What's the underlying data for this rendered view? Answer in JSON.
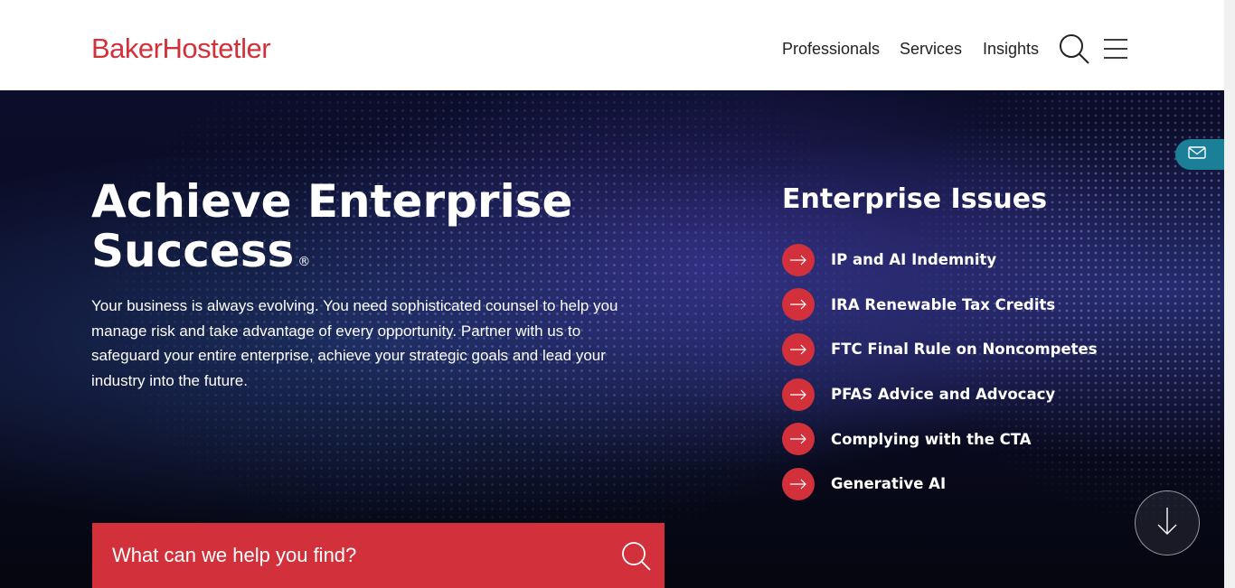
{
  "header": {
    "logo": "BakerHostetler",
    "nav": [
      "Professionals",
      "Services",
      "Insights"
    ],
    "search_icon": "search-icon",
    "menu_icon": "hamburger-menu-icon"
  },
  "hero": {
    "title": "Achieve Enterprise Success",
    "title_mark": "®",
    "text": "Your business is always evolving. You need sophisticated counsel to help you manage risk and take advantage of every opportunity. Partner with us to safeguard your entire enterprise, achieve your strategic goals and lead your industry into the future.",
    "search_placeholder": "What can we help you find?"
  },
  "enterprise_issues": {
    "title": "Enterprise Issues",
    "items": [
      {
        "label": "IP and AI Indemnity"
      },
      {
        "label": "IRA Renewable Tax Credits"
      },
      {
        "label": "FTC Final Rule on Noncompetes"
      },
      {
        "label": "PFAS Advice and Advocacy"
      },
      {
        "label": "Complying with the CTA"
      },
      {
        "label": "Generative AI"
      }
    ]
  },
  "colors": {
    "brand_red": "#d2313b",
    "email_tab": "#1a7f97",
    "hero_bg": "#0b0d2a"
  }
}
